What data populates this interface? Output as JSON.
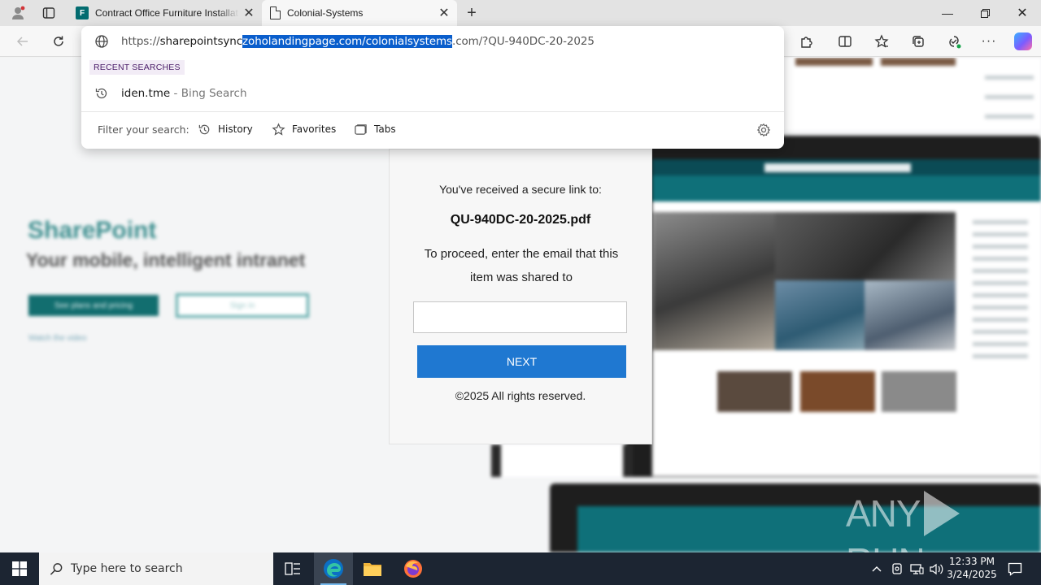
{
  "browser": {
    "tabs": [
      {
        "title": "Contract Office Furniture Installat",
        "favicon": "forms-icon",
        "active": false
      },
      {
        "title": "Colonial-Systems",
        "favicon": "page-icon",
        "active": true
      }
    ],
    "address": {
      "scheme": "https://",
      "host_prefix": "sharepointsync",
      "host_selected": "zoholandingpage.com/colonialsystems",
      "rest": ".com/?QU-940DC-20-2025"
    },
    "dropdown": {
      "recent_label": "RECENT SEARCHES",
      "suggestion_query": "iden.tme",
      "suggestion_source": " - Bing Search",
      "filter_label": "Filter your search:",
      "filters": [
        "History",
        "Favorites",
        "Tabs"
      ]
    }
  },
  "page": {
    "background": {
      "brand": "SharePoint",
      "tagline": "Your mobile, intelligent intranet",
      "btn_primary": "See plans and pricing",
      "btn_secondary": "Sign in",
      "watch_link": "Watch the video"
    },
    "card": {
      "received": "You've received a secure link to:",
      "filename": "QU-940DC-20-2025.pdf",
      "instructions": "To proceed, enter the email that this item was shared to",
      "email_value": "",
      "next_label": "NEXT",
      "copyright": "©2025 All rights reserved."
    },
    "watermark": {
      "left": "ANY",
      "right": "RUN"
    }
  },
  "taskbar": {
    "search_placeholder": "Type here to search",
    "time": "12:33 PM",
    "date": "3/24/2025"
  },
  "colors": {
    "accent_blue": "#1f78d1",
    "selection": "#0a5ecc",
    "sharepoint_teal": "#126e6f",
    "taskbar": "#1c2532"
  }
}
